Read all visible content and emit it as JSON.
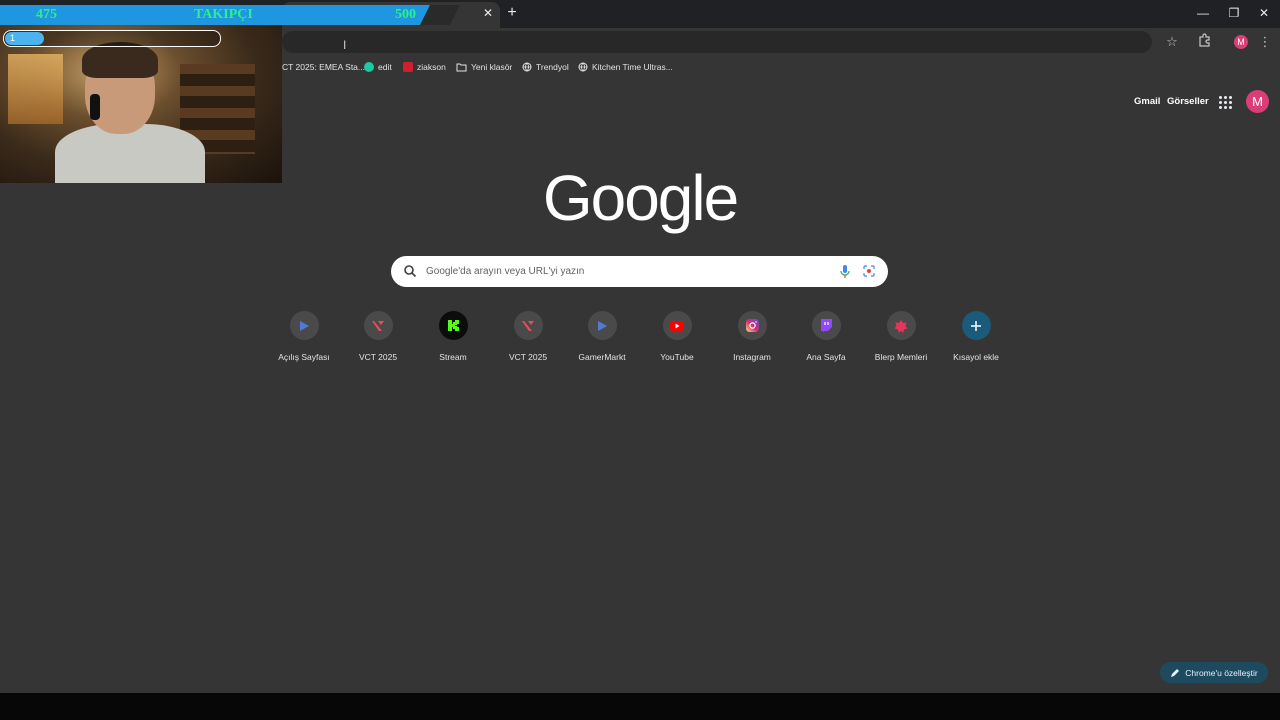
{
  "browser": {
    "tab_close": "✕",
    "new_tab": "+",
    "window_controls": [
      "—",
      "❐",
      "✕"
    ]
  },
  "bookmarks": [
    {
      "label": "CT 2025: EMEA Sta...",
      "color": "#353535"
    },
    {
      "label": "edit",
      "color": "#1ec8a0"
    },
    {
      "label": "ziakson",
      "color": "#d02030"
    },
    {
      "label": "Yeni klasör",
      "color": "#353535"
    },
    {
      "label": "Trendyol",
      "color": "#353535"
    },
    {
      "label": "Kitchen Time Ultras...",
      "color": "#353535"
    }
  ],
  "header": {
    "gmail": "Gmail",
    "images": "Görseller",
    "avatar_letter": "M",
    "avatar_color": "#d93f76"
  },
  "logo": "Google",
  "search": {
    "placeholder": "Google'da arayın veya URL'yi yazın"
  },
  "shortcuts": [
    {
      "label": "Açılış Sayfası",
      "icon": "play-triangle-icon",
      "color": "#4f7bd6"
    },
    {
      "label": "VCT 2025",
      "icon": "valorant-icon",
      "color": "#ef4a5a"
    },
    {
      "label": "Stream",
      "icon": "kick-icon",
      "color": "#53fc18"
    },
    {
      "label": "VCT 2025",
      "icon": "valorant-icon",
      "color": "#ef4a5a"
    },
    {
      "label": "GamerMarkt",
      "icon": "play-triangle-icon",
      "color": "#4f7bd6"
    },
    {
      "label": "YouTube",
      "icon": "youtube-icon",
      "color": "#ff0000"
    },
    {
      "label": "Instagram",
      "icon": "instagram-icon",
      "color": "#d6249f"
    },
    {
      "label": "Ana Sayfa",
      "icon": "twitch-icon",
      "color": "#9146ff"
    },
    {
      "label": "Blerp Memleri",
      "icon": "blerp-icon",
      "color": "#e8345a"
    },
    {
      "label": "Kısayol ekle",
      "icon": "plus-icon",
      "color": "#1a5a7a"
    }
  ],
  "customize_label": "Chrome'u özelleştir",
  "overlay": {
    "followers_current": "475",
    "followers_label": "TAKIPÇI",
    "followers_goal": "500",
    "goal_number": "1",
    "goal_progress": 0.18
  }
}
